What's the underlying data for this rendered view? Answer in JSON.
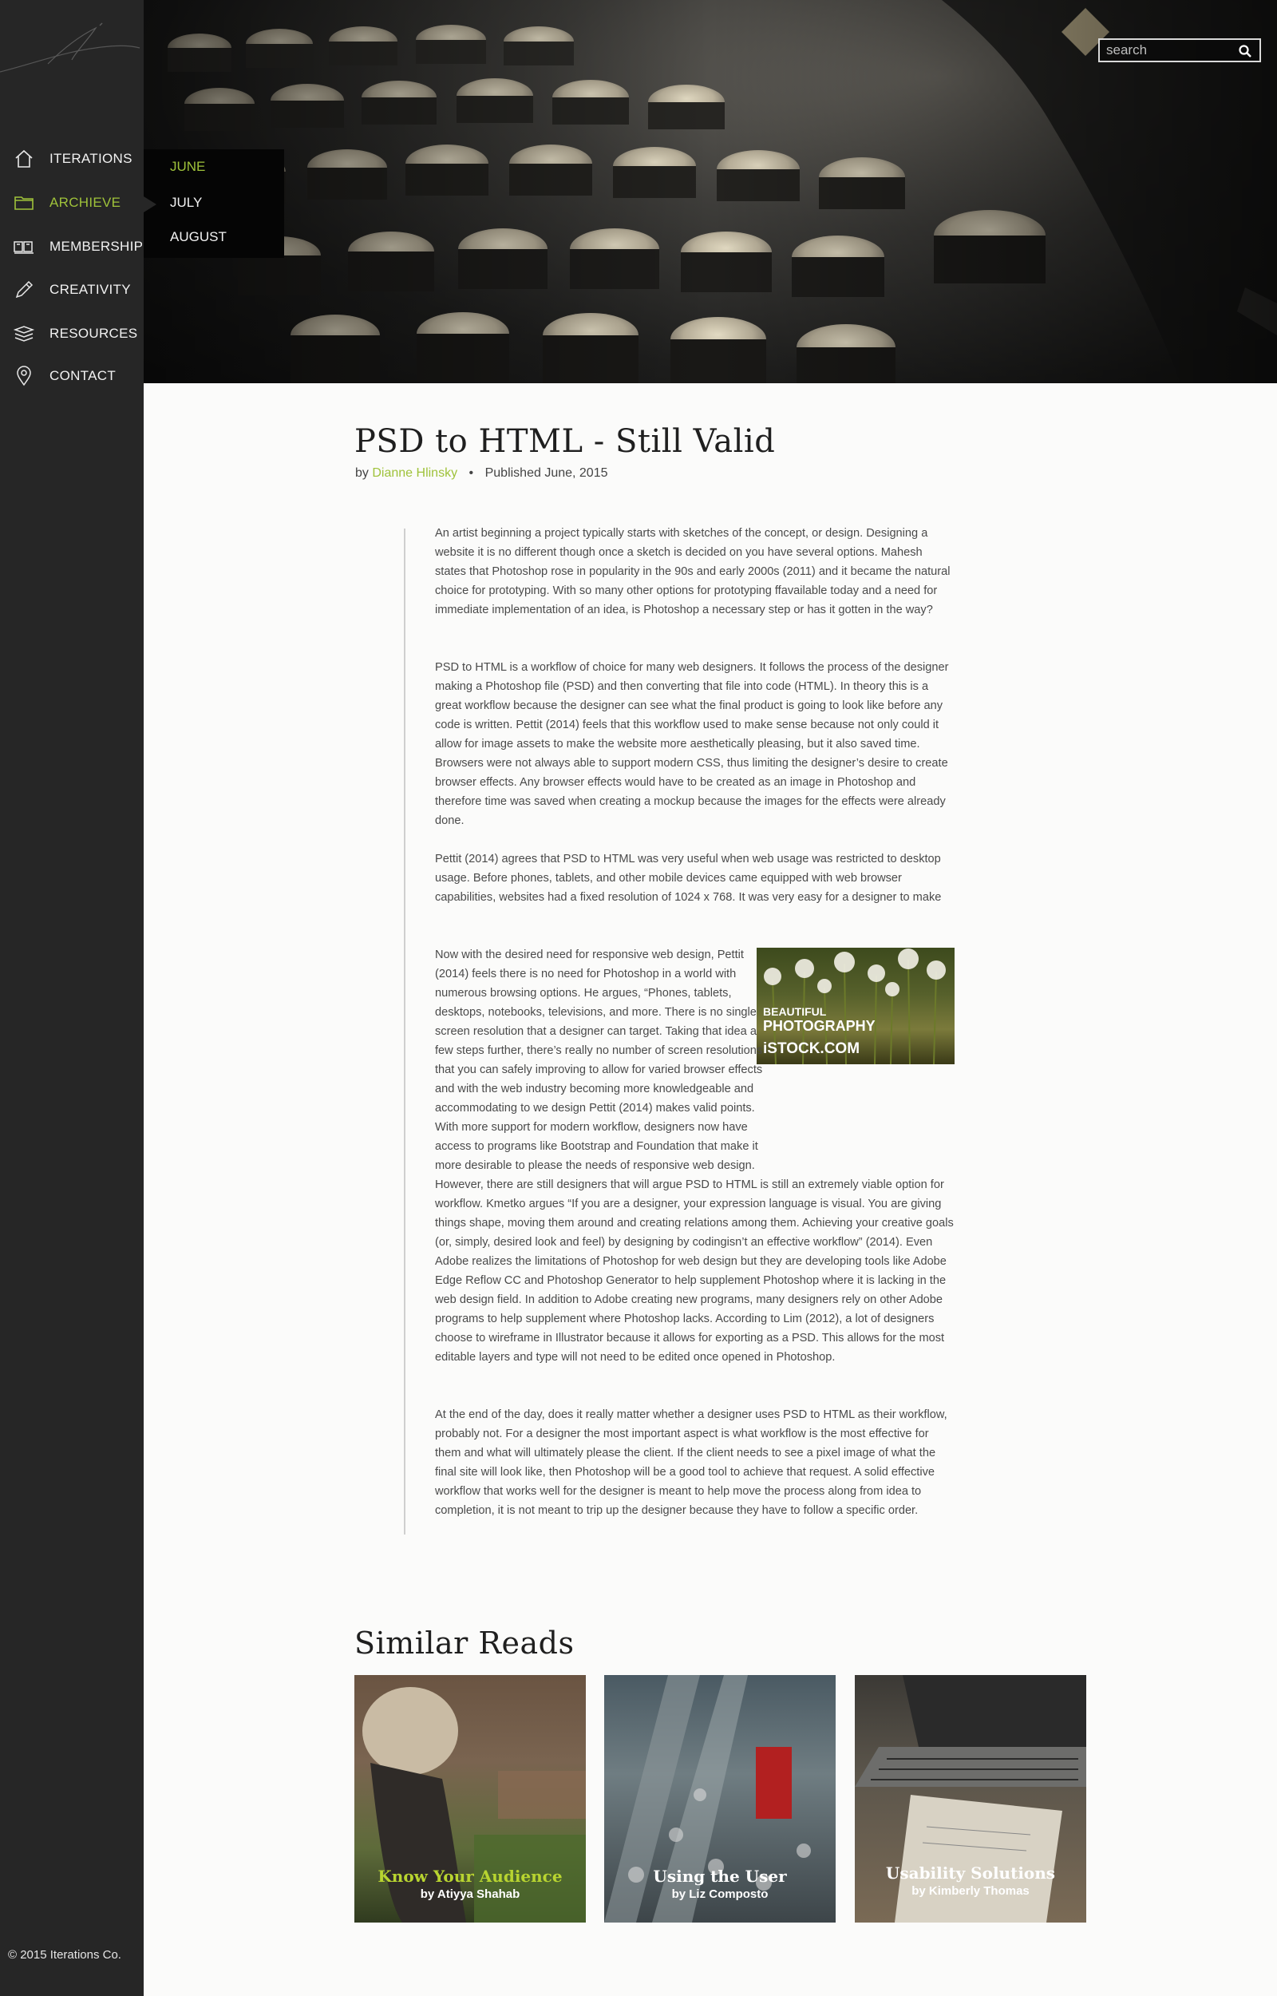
{
  "sidebar": {
    "items": [
      {
        "label": "ITERATIONS",
        "icon": "home-icon"
      },
      {
        "label": "ARCHIEVE",
        "icon": "folder-icon",
        "active": true
      },
      {
        "label": "MEMBERSHIP",
        "icon": "books-icon"
      },
      {
        "label": "CREATIVITY",
        "icon": "pencil-icon"
      },
      {
        "label": "RESOURCES",
        "icon": "stack-icon"
      },
      {
        "label": "CONTACT",
        "icon": "location-pin-icon"
      }
    ],
    "copyright": "© 2015 Iterations Co."
  },
  "archive_menu": {
    "items": [
      "JUNE",
      "JULY",
      "AUGUST"
    ],
    "active": "JUNE"
  },
  "search": {
    "placeholder": "search"
  },
  "article": {
    "title": "PSD to HTML - Still Valid",
    "by": "by",
    "author": "Dianne Hlinsky",
    "separator": "•",
    "published": "Published June, 2015",
    "paragraphs": [
      "An artist beginning a project typically starts with sketches of the concept, or design. Designing a website it is no different though once a sketch is decided on you have several options. Mahesh states that Photoshop rose in popularity in the 90s and early 2000s (2011) and it became the natural choice for prototyping. With so many other options for prototyping ffavailable today and a need for immediate implementation of an idea, is Photoshop a necessary step or has it gotten in the way?",
      "PSD to HTML is a workflow of choice for many web designers. It follows the process of the designer making a Photoshop file (PSD) and then converting that file into code (HTML). In theory this is a great workflow because the designer can see what the final product is going to look like before any code is written. Pettit (2014) feels that this workflow used to make sense because not only could it allow for image assets to make the website more aesthetically pleasing, but it also saved time. Browsers were not always able to support modern CSS, thus limiting the designer’s desire to create browser effects. Any browser effects would have to be created as an image in Photoshop and therefore time was saved when creating a mockup because the images for the effects were already done.",
      "Pettit (2014) agrees that PSD to HTML was very useful when web usage was restricted to desktop usage. Before phones, tablets, and other mobile devices came equipped with web browser capabilities, websites had a fixed resolution of 1024 x 768. It was very easy for a designer to make",
      "Now with the desired need for responsive web design, Pettit (2014) feels there is no need for Photoshop in a world with numerous browsing options. He argues, “Phones, tablets, desktops, notebooks, televisions, and more. There is no single screen resolution that a designer can target. Taking that idea a few steps further, there’s really no number of screen resolutions that you can safely improving to allow for varied browser effects and with the web industry becoming more knowledgeable and accommodating to we design Pettit (2014) makes valid points. With more support for modern workflow, designers now have access to programs like Bootstrap and Foundation that make it more desirable to please the needs of responsive web design.",
      "However, there are still designers that will argue PSD to HTML is still an extremely viable option for workflow. Kmetko argues “If you are a designer, your expression language is visual. You are giving things shape, moving them around and creating relations among them. Achieving your creative goals (or, simply, desired look and feel) by designing by codingisn’t an effective workflow” (2014). Even Adobe realizes the limitations of Photoshop for web design but they are developing tools like Adobe Edge Reflow CC and Photoshop Generator to help supplement Photoshop where it is lacking in the web design field. In addition to Adobe creating new programs, many designers rely on other Adobe programs to help supplement where Photoshop lacks. According to Lim (2012), a lot of designers choose to wireframe in Illustrator because it allows for exporting as a PSD. This allows for the most editable layers and type will not need to be edited once opened in Photoshop.",
      "At the end of the day, does it really matter whether a designer uses PSD to HTML as their workflow, probably not. For a designer the most important aspect is what workflow is the most effective for them and what will ultimately please the client. If the client needs to see a pixel image of what the final site will look like, then Photoshop will be a good tool to achieve that request. A solid effective workflow that works well for the designer is meant to help move the process along from idea to completion, it is not meant to trip up the designer because they have to follow a specific order."
    ],
    "inset_image": {
      "line1": "BEAUTIFUL",
      "line2": "PHOTOGRAPHY",
      "line3": "iSTOCK.COM"
    }
  },
  "similar": {
    "title": "Similar Reads",
    "cards": [
      {
        "title": "Know Your Audience",
        "author": "by Atiyya Shahab",
        "title_color": "#b8d430"
      },
      {
        "title": "Using the User",
        "author": "by Liz Composto",
        "title_color": "#ffffff"
      },
      {
        "title": "Usability Solutions",
        "author": "by Kimberly Thomas",
        "title_color": "#ffffff"
      }
    ]
  },
  "colors": {
    "accent": "#9fc23a",
    "sidebar": "#262626",
    "dropdown": "#050505"
  }
}
